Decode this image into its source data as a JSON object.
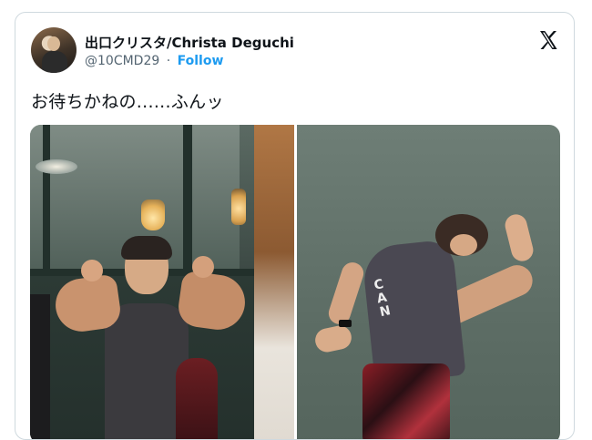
{
  "tweet": {
    "author": {
      "display_name": "出口クリスタ/Christa Deguchi",
      "handle": "@10CMD29",
      "separator": "·",
      "follow_label": "Follow"
    },
    "platform_icon": "x-logo-icon",
    "text": "お待ちかねの......ふんッ",
    "media": {
      "photo_count": 2,
      "right_photo_shirt_text": "CAN"
    }
  }
}
